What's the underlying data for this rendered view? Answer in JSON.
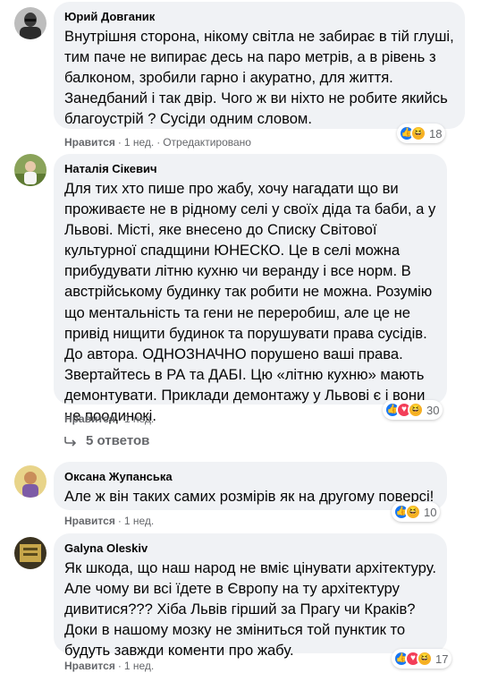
{
  "comments": [
    {
      "author": "Юрий Довганик",
      "text": "Внутрішня сторона, нікому світла не забирає в тій глуші, тим паче не випирає десь на паро метрів, а в рівень з балконом, зробили гарно і акуратно, для життя. Занедбаний і так двір. Чого ж ви ніхто не робите якийсь благоустрій ? Сусіди одним словом.",
      "like_label": "Нравится",
      "time": "1 нед.",
      "edited": "Отредактировано",
      "reaction_count": "18",
      "reactions": [
        "like-icon",
        "haha-icon"
      ]
    },
    {
      "author": "Наталія Сікевич",
      "text": "Для тих хто пише про жабу, хочу нагадати що ви проживаєте не в рідному селі у своїх діда та баби, а у Львові. Місті, яке внесено до Списку Світової культурної спадщини ЮНЕСКО. Це в селі можна прибудувати літню кухню чи веранду і все норм. В австрійському будинку так робити не можна. Розумію що ментальність та гени не переробиш, але це не привід нищити будинок та порушувати права сусідів. До автора. ОДНОЗНАЧНО порушено ваші права. Звертайтесь в РА та ДАБІ. Цю «літню кухню» мають демонтувати. Приклади демонтажу у Львові є і вони не поодинокі.",
      "like_label": "Нравится",
      "time": "1 нед.",
      "reaction_count": "30",
      "reactions": [
        "like-icon",
        "love-icon",
        "haha-icon"
      ],
      "replies_label": "5 ответов"
    },
    {
      "author": "Оксана Жупанська",
      "text": "Але ж він таких самих розмірів як на другому поверсі!",
      "like_label": "Нравится",
      "time": "1 нед.",
      "reaction_count": "10",
      "reactions": [
        "like-icon",
        "haha-icon"
      ]
    },
    {
      "author": "Galyna Oleskiv",
      "text": "Як шкода, що наш народ не вміє цінувати архітектуру. Але чому ви всі їдете в Європу на ту архітектуру дивитися??? Хіба Львів гірший за Прагу чи Краків? Доки в нашому мозку не зміниться той пунктик то будуть завжди коменти про жабу.",
      "like_label": "Нравится",
      "time": "1 нед.",
      "reaction_count": "17",
      "reactions": [
        "like-icon",
        "love-icon",
        "haha-icon"
      ]
    }
  ],
  "colors": {
    "bubble": "#f0f2f5",
    "meta": "#65676b",
    "like_blue": "#1877f2",
    "love_red": "#f33e58",
    "haha_yellow": "#f7b125"
  }
}
